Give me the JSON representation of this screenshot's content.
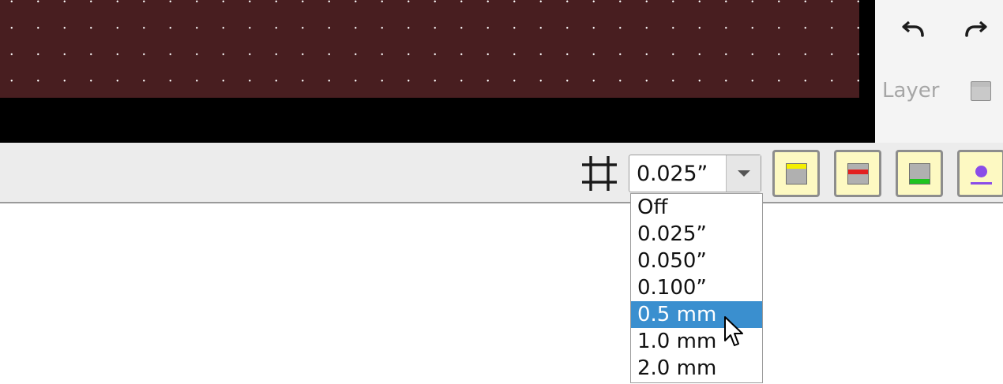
{
  "canvas": {
    "board_color": "#481e20",
    "background_color": "#000000",
    "grid_dot_color": "#ffffff"
  },
  "side_panel": {
    "undo_icon": "undo-icon",
    "redo_icon": "redo-icon",
    "layer_label": "Layer",
    "layer_swatch_icon": "layer-swatch-icon"
  },
  "toolbar": {
    "grid_icon": "grid-icon",
    "grid_select": {
      "value": "0.025”",
      "options": [
        "Off",
        "0.025”",
        "0.050”",
        "0.100”",
        "0.5 mm",
        "1.0 mm",
        "2.0 mm"
      ],
      "highlighted": "0.5 mm"
    },
    "layer_buttons": [
      {
        "icon": "layer-top-yellow-icon",
        "accent": "#f5ef00"
      },
      {
        "icon": "layer-mid-red-icon",
        "accent": "#e32020"
      },
      {
        "icon": "layer-bottom-green-icon",
        "accent": "#1fc41f"
      },
      {
        "icon": "layer-purple-dot-icon",
        "accent": "#8a4de8"
      }
    ]
  },
  "colors": {
    "highlight": "#3a8fcf",
    "toolbar_bg": "#ececec",
    "button_bg": "#fdf9c2"
  }
}
